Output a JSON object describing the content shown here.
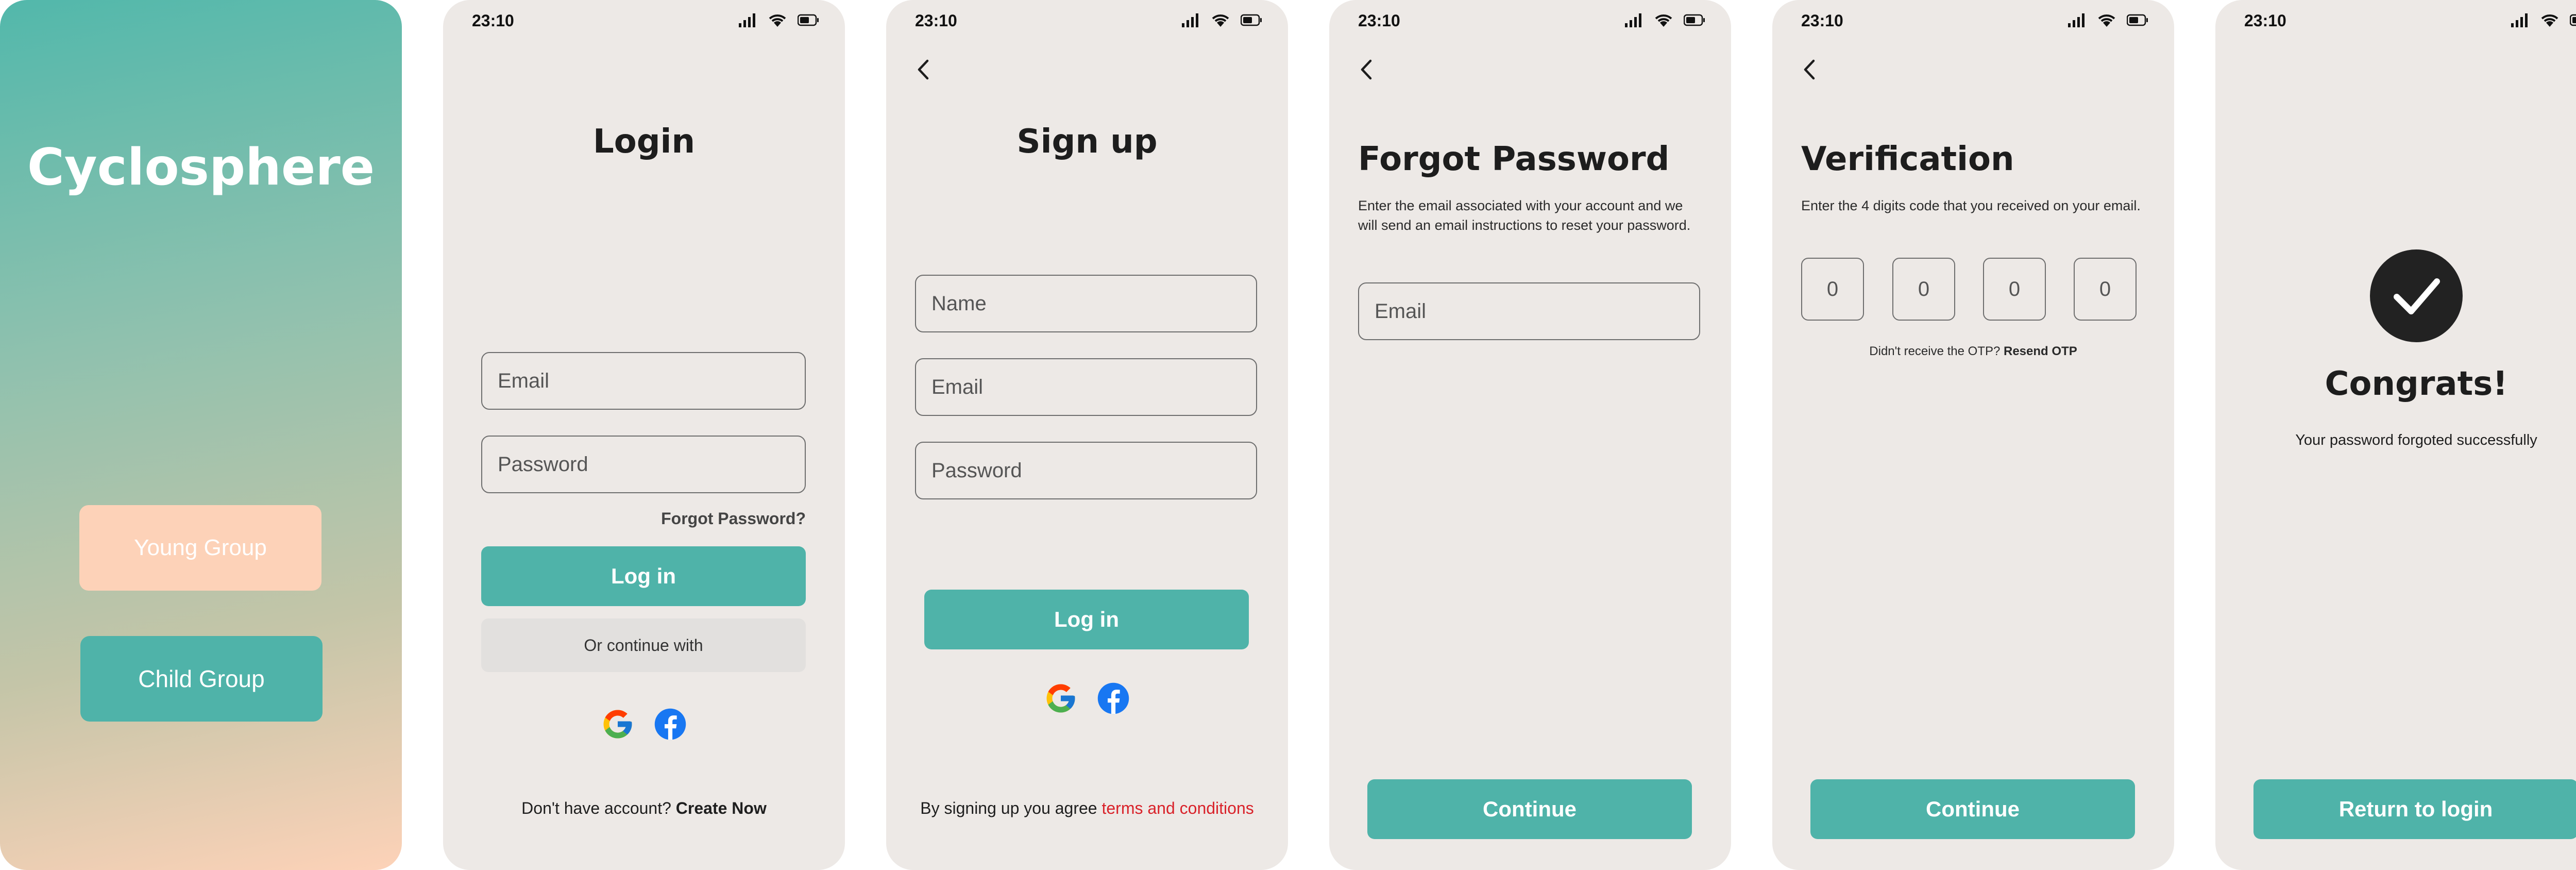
{
  "status": {
    "time": "23:10"
  },
  "splash": {
    "title": "Cyclosphere",
    "young_group": "Young Group",
    "child_group": "Child Group",
    "colors": {
      "young": "#fdd2b8",
      "child": "#4fb3a9"
    }
  },
  "login": {
    "title": "Login",
    "email_placeholder": "Email",
    "password_placeholder": "Password",
    "forgot_link": "Forgot Password?",
    "login_button": "Log in",
    "continue_with": "Or continue with",
    "no_account": "Don't have account?",
    "create_now": "Create Now"
  },
  "signup": {
    "title": "Sign up",
    "name_placeholder": "Name",
    "email_placeholder": "Email",
    "password_placeholder": "Password",
    "login_button": "Log in",
    "agree_text": "By signing up you agree",
    "terms_link": "terms and conditions"
  },
  "forgot": {
    "title": "Forgot Password",
    "description": "Enter the email associated with your account and we will send an email instructions to reset your password.",
    "email_placeholder": "Email",
    "continue_button": "Continue"
  },
  "verification": {
    "title": "Verification",
    "description": "Enter the 4 digits code that you received on your email.",
    "digits": [
      "0",
      "0",
      "0",
      "0"
    ],
    "no_otp": "Didn't receive the OTP?",
    "resend": "Resend OTP",
    "continue_button": "Continue"
  },
  "congrats": {
    "title": "Congrats!",
    "message": "Your password forgoted successfully",
    "return_button": "Return to login"
  },
  "colors": {
    "accent": "#4fb3a9",
    "background": "#ede9e6",
    "link_red": "#d9222a"
  },
  "icons": [
    "signal-icon",
    "wifi-icon",
    "battery-icon",
    "back-arrow-icon",
    "google-icon",
    "facebook-icon",
    "check-icon"
  ]
}
